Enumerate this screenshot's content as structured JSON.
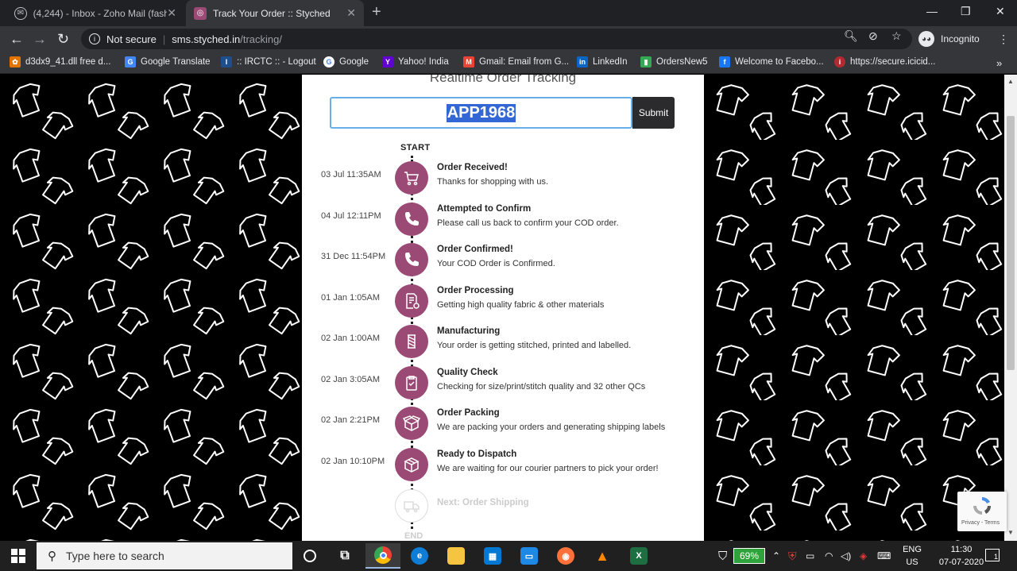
{
  "browser": {
    "tabs": [
      {
        "title": "(4,244) - Inbox - Zoho Mail (fashi",
        "active": false
      },
      {
        "title": "Track Your Order :: Styched",
        "active": true
      }
    ],
    "url_host": "sms.styched.in",
    "url_path": "/tracking/",
    "security_label": "Not secure",
    "profile_label": "Incognito",
    "bookmarks": [
      {
        "label": "d3dx9_41.dll free d...",
        "icon": "gear-icon",
        "color": "#e37400"
      },
      {
        "label": "Google Translate",
        "icon": "translate-icon",
        "color": "#4285f4"
      },
      {
        "label": ":: IRCTC :: - Logout",
        "icon": "irctc-icon",
        "color": "#1f4e8c"
      },
      {
        "label": "Google",
        "icon": "google-icon",
        "color": "#ffffff"
      },
      {
        "label": "Yahoo! India",
        "icon": "yahoo-icon",
        "color": "#6001d2"
      },
      {
        "label": "Gmail: Email from G...",
        "icon": "gmail-icon",
        "color": "#ea4335"
      },
      {
        "label": "LinkedIn",
        "icon": "linkedin-icon",
        "color": "#0a66c2"
      },
      {
        "label": "OrdersNew5",
        "icon": "orders-icon",
        "color": "#34a853"
      },
      {
        "label": "Welcome to Facebo...",
        "icon": "facebook-icon",
        "color": "#1877f2"
      },
      {
        "label": "https://secure.icicid...",
        "icon": "icici-icon",
        "color": "#b02a30"
      }
    ]
  },
  "page": {
    "title": "Realtime Order Tracking",
    "order_id": "APP1968",
    "submit_label": "Submit",
    "start_label": "START",
    "end_label": "END",
    "accent_color": "#9b4a75",
    "steps": [
      {
        "time": "03 Jul 11:35AM",
        "title": "Order Received!",
        "desc": "Thanks for shopping with us.",
        "icon": "cart-icon"
      },
      {
        "time": "04 Jul 12:11PM",
        "title": "Attempted to Confirm",
        "desc": "Please call us back to confirm your COD order.",
        "icon": "phone-icon"
      },
      {
        "time": "31 Dec 11:54PM",
        "title": "Order Confirmed!",
        "desc": "Your COD Order is Confirmed.",
        "icon": "phone-icon"
      },
      {
        "time": "01 Jan 1:05AM",
        "title": "Order Processing",
        "desc": "Getting high quality fabric & other materials",
        "icon": "document-gear-icon"
      },
      {
        "time": "02 Jan 1:00AM",
        "title": "Manufacturing",
        "desc": "Your order is getting stitched, printed and labelled.",
        "icon": "thread-spool-icon"
      },
      {
        "time": "02 Jan 3:05AM",
        "title": "Quality Check",
        "desc": "Checking for size/print/stitch quality and 32 other QCs",
        "icon": "clipboard-check-icon"
      },
      {
        "time": "02 Jan 2:21PM",
        "title": "Order Packing",
        "desc": "We are packing your orders and generating shipping labels",
        "icon": "open-box-icon"
      },
      {
        "time": "02 Jan 10:10PM",
        "title": "Ready to Dispatch",
        "desc": "We are waiting for our courier partners to pick your order!",
        "icon": "closed-box-icon"
      }
    ],
    "next_step": {
      "title": "Next: Order Shipping",
      "icon": "truck-icon"
    },
    "recaptcha_text": "Privacy - Terms"
  },
  "taskbar": {
    "search_placeholder": "Type here to search",
    "battery_percent": "69%",
    "language": "ENG",
    "region": "US",
    "time": "11:30",
    "date": "07-07-2020",
    "notification_count": "1"
  }
}
